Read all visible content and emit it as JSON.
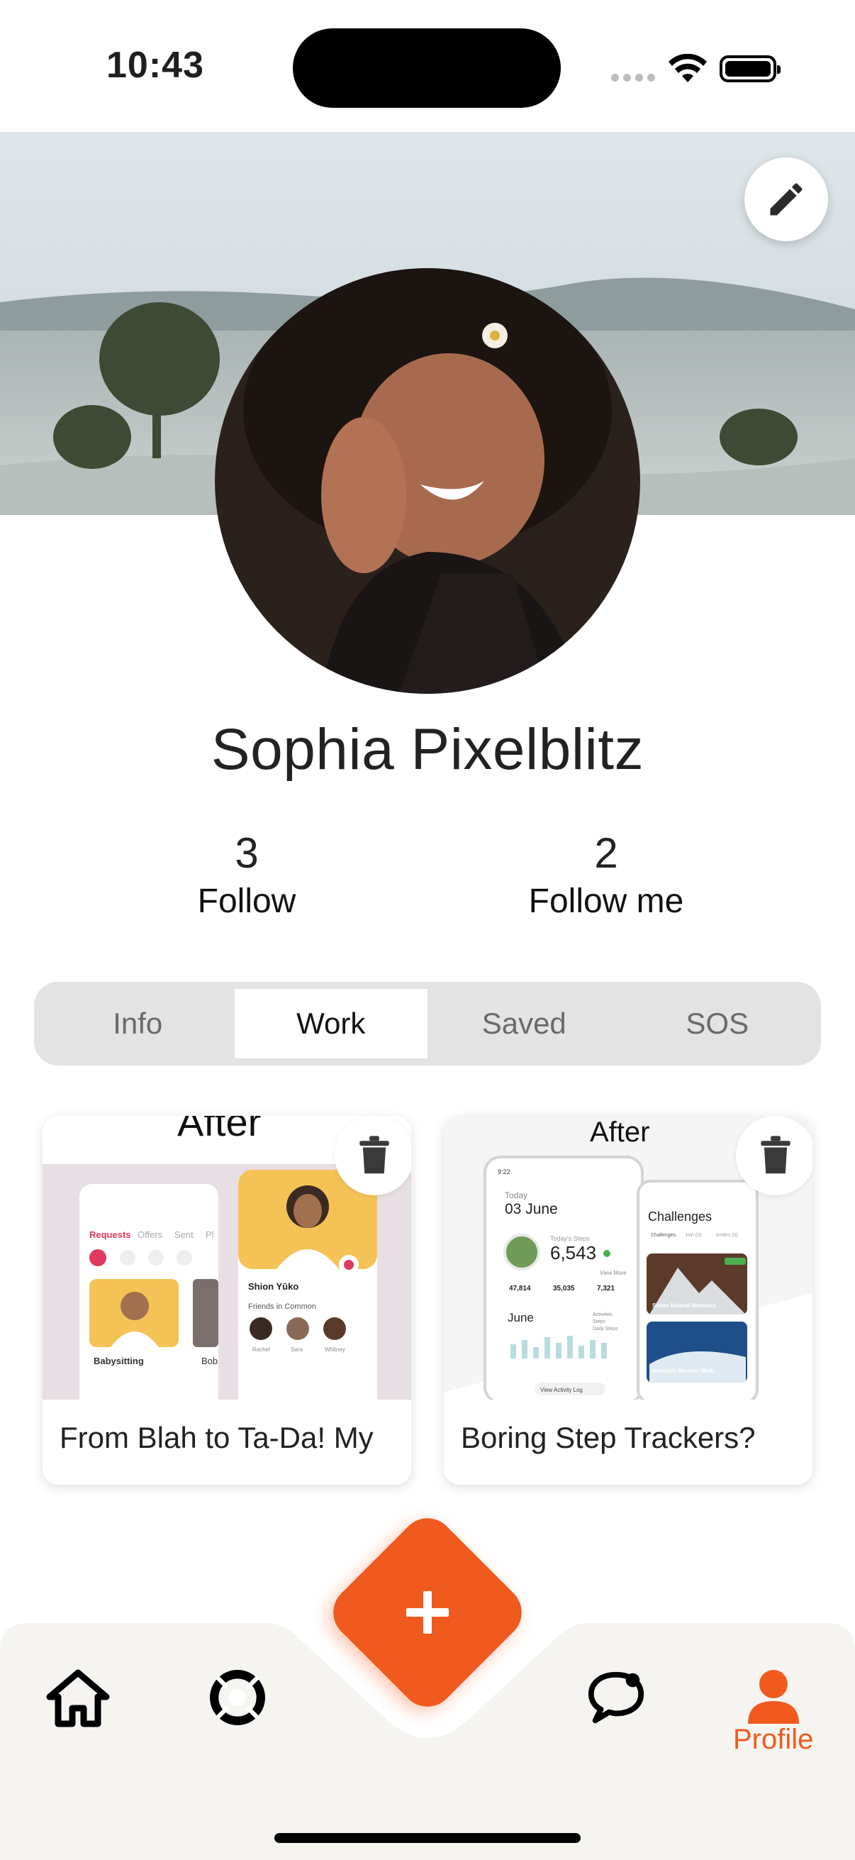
{
  "status": {
    "time": "10:43"
  },
  "profile": {
    "name": "Sophia Pixelblitz"
  },
  "stats": [
    {
      "value": "3",
      "label": "Follow"
    },
    {
      "value": "2",
      "label": "Follow me"
    }
  ],
  "tabs": [
    {
      "label": "Info",
      "active": false
    },
    {
      "label": "Work",
      "active": true
    },
    {
      "label": "Saved",
      "active": false
    },
    {
      "label": "SOS",
      "active": false
    }
  ],
  "cards": [
    {
      "title": "From Blah to Ta-Da! My",
      "preview": {
        "heading": "After",
        "tabs": [
          "Requests",
          "Offers",
          "Sent",
          "Pl"
        ],
        "item_label": "Babysitting",
        "item_label_2": "Bob",
        "person_name": "Shion Yūko",
        "friends_label": "Friends in Common",
        "friend_names": [
          "Rachel",
          "Sara",
          "Whitney"
        ]
      }
    },
    {
      "title": "Boring Step Trackers?",
      "preview": {
        "heading": "After",
        "status_time": "9:22",
        "date_label": "Today",
        "date": "03 June",
        "steps_label": "Today's Steps",
        "steps": "6,543",
        "view_more": "View More",
        "stats": [
          "47,814",
          "35,035",
          "7,321"
        ],
        "month": "June",
        "legend": [
          "Activities",
          "Steps",
          "Daily Steps"
        ],
        "button": "View Activity Log",
        "challenges_title": "Challenges",
        "challenge_tabs": [
          "Challenges",
          "Join (0)",
          "Invites (0)"
        ],
        "challenge_1": "Seven Natural Wonders",
        "challenge_2": "Antarctic Wonder Walk"
      }
    }
  ],
  "nav": {
    "items": [
      {
        "icon": "home-icon",
        "label": ""
      },
      {
        "icon": "lifebuoy-icon",
        "label": ""
      },
      {
        "icon": "chat-icon",
        "label": ""
      },
      {
        "icon": "profile-icon",
        "label": "Profile"
      }
    ],
    "fab_icon": "plus-icon",
    "accent": "#f15a1e"
  }
}
